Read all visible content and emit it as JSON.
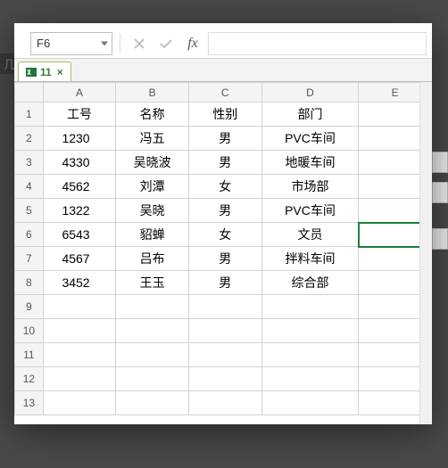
{
  "bg_hint": "几列",
  "namebox_value": "F6",
  "fx_value": "",
  "tab_label": "11",
  "columns": [
    "A",
    "B",
    "C",
    "D",
    "E"
  ],
  "row_numbers": [
    1,
    2,
    3,
    4,
    5,
    6,
    7,
    8,
    9,
    10,
    11,
    12,
    13
  ],
  "header_row": {
    "a": "工号",
    "b": "名称",
    "c": "性别",
    "d": "部门"
  },
  "rows": [
    {
      "a": "1230",
      "b": "冯五",
      "c": "男",
      "d": "PVC车间"
    },
    {
      "a": "4330",
      "b": "吴晓波",
      "c": "男",
      "d": "地暖车间"
    },
    {
      "a": "4562",
      "b": "刘潭",
      "c": "女",
      "d": "市场部"
    },
    {
      "a": "1322",
      "b": "吴晓",
      "c": "男",
      "d": "PVC车间"
    },
    {
      "a": "6543",
      "b": "貂蝉",
      "c": "女",
      "d": "文员"
    },
    {
      "a": "4567",
      "b": "吕布",
      "c": "男",
      "d": "拌料车间"
    },
    {
      "a": "3452",
      "b": "王玉",
      "c": "男",
      "d": "综合部"
    }
  ],
  "active_cell": "F6",
  "active_row": 6
}
